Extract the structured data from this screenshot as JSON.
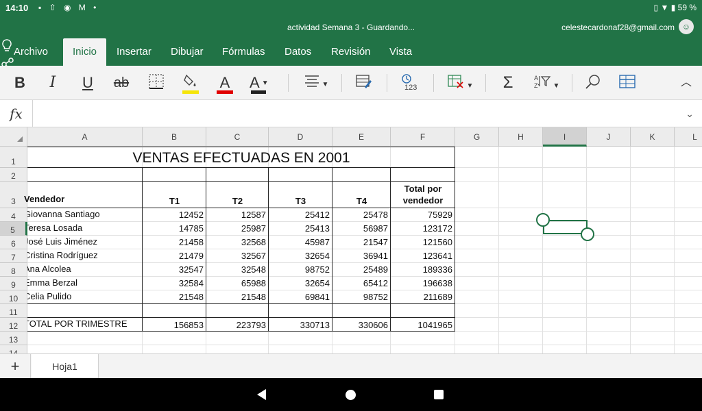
{
  "status": {
    "time": "14:10",
    "battery": "59 %"
  },
  "title": {
    "document": "actividad Semana 3 - Guardando...",
    "email": "celestecardonaf28@gmail.com"
  },
  "tabs": [
    {
      "label": "Archivo"
    },
    {
      "label": "Inicio"
    },
    {
      "label": "Insertar"
    },
    {
      "label": "Dibujar"
    },
    {
      "label": "Fórmulas"
    },
    {
      "label": "Datos"
    },
    {
      "label": "Revisión"
    },
    {
      "label": "Vista"
    }
  ],
  "toolbar": {
    "bold": "B",
    "italic": "I",
    "underline": "U",
    "strike": "ab",
    "font_color_glyph": "A",
    "highlight_color": "#f5e50a",
    "font_color": "#e00000",
    "text_color": "#222222",
    "autosum": "Σ"
  },
  "formula": {
    "fx": "fx"
  },
  "columns": [
    "A",
    "B",
    "C",
    "D",
    "E",
    "F",
    "G",
    "H",
    "I",
    "J",
    "K",
    "L"
  ],
  "rows": [
    "1",
    "2",
    "3",
    "4",
    "5",
    "6",
    "7",
    "8",
    "9",
    "10",
    "11",
    "12",
    "13",
    "14"
  ],
  "sheet": {
    "title": "VENTAS EFECTUADAS EN 2001",
    "headers": {
      "vendedor": "Vendedor",
      "t1": "T1",
      "t2": "T2",
      "t3": "T3",
      "t4": "T4",
      "total_line1": "Total por",
      "total_line2": "vendedor"
    },
    "data": [
      {
        "name": "Giovanna Santiago",
        "t1": "12452",
        "t2": "12587",
        "t3": "25412",
        "t4": "25478",
        "total": "75929"
      },
      {
        "name": "Teresa Losada",
        "t1": "14785",
        "t2": "25987",
        "t3": "25413",
        "t4": "56987",
        "total": "123172"
      },
      {
        "name": "José Luis Jiménez",
        "t1": "21458",
        "t2": "32568",
        "t3": "45987",
        "t4": "21547",
        "total": "121560"
      },
      {
        "name": "Cristina Rodríguez",
        "t1": "21479",
        "t2": "32567",
        "t3": "32654",
        "t4": "36941",
        "total": "123641"
      },
      {
        "name": "Ana Alcolea",
        "t1": "32547",
        "t2": "32548",
        "t3": "98752",
        "t4": "25489",
        "total": "189336"
      },
      {
        "name": "Emma Berzal",
        "t1": "32584",
        "t2": "65988",
        "t3": "32654",
        "t4": "65412",
        "total": "196638"
      },
      {
        "name": "Celia Pulido",
        "t1": "21548",
        "t2": "21548",
        "t3": "69841",
        "t4": "98752",
        "total": "211689"
      }
    ],
    "totals": {
      "label": "TOTAL POR TRIMESTRE",
      "t1": "156853",
      "t2": "223793",
      "t3": "330713",
      "t4": "330606",
      "total": "1041965"
    }
  },
  "sheet_tabs": [
    {
      "label": "Hoja1"
    }
  ],
  "selected": {
    "column": "I",
    "row": "5"
  }
}
